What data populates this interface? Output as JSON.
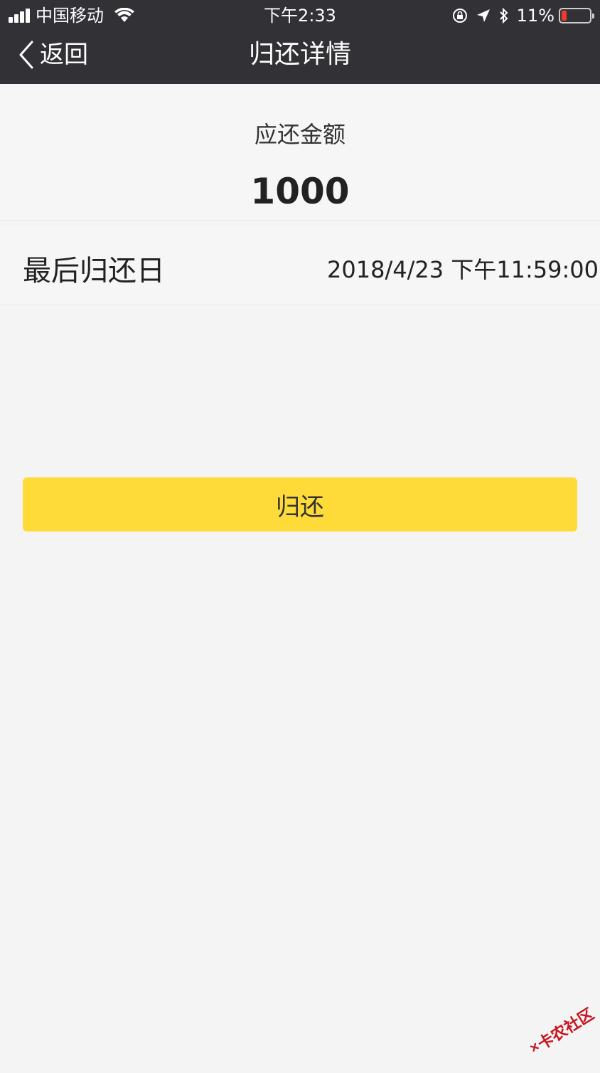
{
  "status_bar": {
    "carrier": "中国移动",
    "time": "下午2:33",
    "battery": "11%",
    "battery_level": 0.11
  },
  "nav": {
    "back_label": "返回",
    "title": "归还详情"
  },
  "amount": {
    "label": "应还金额",
    "value": "1000"
  },
  "due_date": {
    "label": "最后归还日",
    "value": "2018/4/23 下午11:59:00"
  },
  "action": {
    "button_label": "归还",
    "color": "#ffdb3a"
  },
  "watermark": {
    "text": "卡农社区"
  },
  "colors": {
    "topbar": "#323236",
    "background": "#f4f4f4"
  }
}
